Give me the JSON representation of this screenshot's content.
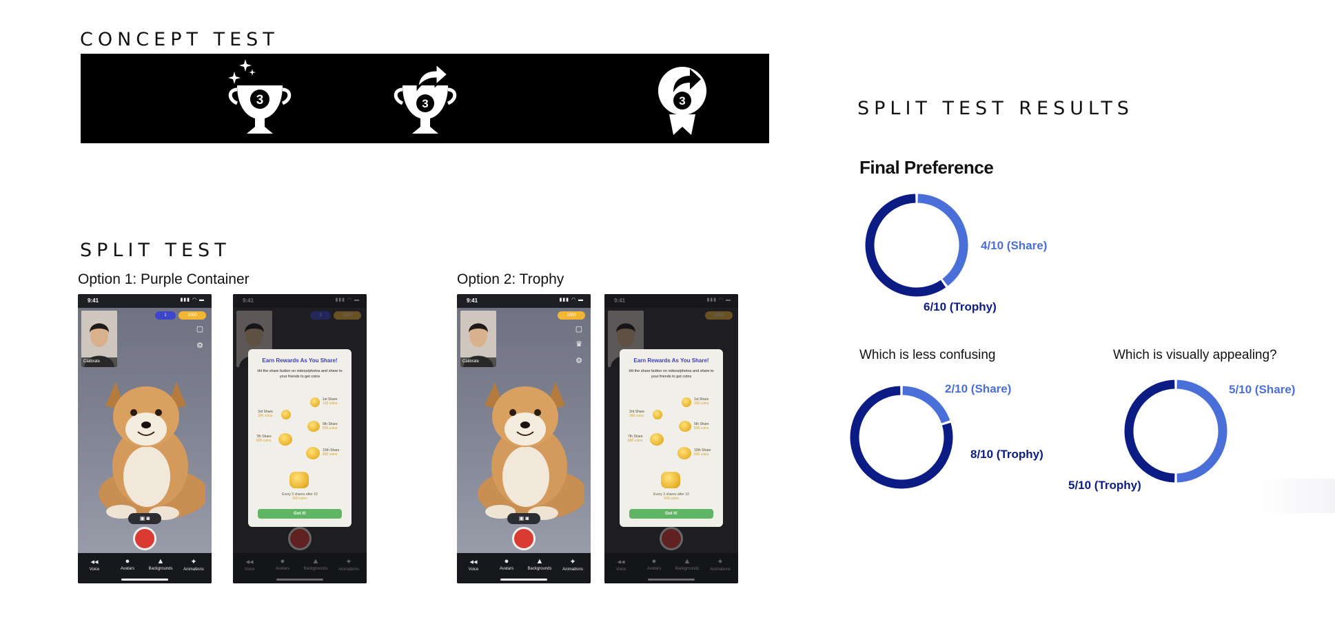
{
  "concept": {
    "title": "CONCEPT TEST",
    "badge_number": "3"
  },
  "split_test": {
    "title": "SPLIT TEST",
    "options": [
      {
        "label": "Option 1: Purple Container",
        "variant": "purple-container"
      },
      {
        "label": "Option 2: Trophy",
        "variant": "trophy"
      }
    ],
    "phone": {
      "time": "9:41",
      "calibrate": "Calibrate",
      "pill_count": "1",
      "pill_coins": "1000",
      "discover": "Discover",
      "rewards": "Rewards",
      "tabs": [
        "Voice",
        "Avatars",
        "Backgrounds",
        "Animations"
      ]
    },
    "modal": {
      "title": "Earn Rewards As You Share!",
      "text": "Hit the share button on videos/photos and share to your friends to get coins",
      "rewards": [
        {
          "label": "1st Share",
          "coins": "100 coins"
        },
        {
          "label": "3rd Share",
          "coins": "300 coins"
        },
        {
          "label": "5th Share",
          "coins": "500 coins"
        },
        {
          "label": "7th Share",
          "coins": "800 coins"
        },
        {
          "label": "10th Share",
          "coins": "800 coins"
        }
      ],
      "footer_line1": "Every 3 shares after 10",
      "footer_line2": "500 coins",
      "button": "Got it!"
    }
  },
  "results": {
    "title": "SPLIT TEST RESULTS"
  },
  "colors": {
    "share": "#4a6fd9",
    "trophy": "#0c1c85",
    "banner": "#000000",
    "got_it": "#5fb563",
    "record": "#d93a31"
  },
  "chart_data": [
    {
      "type": "pie",
      "title": "Final Preference",
      "categories": [
        "Share",
        "Trophy"
      ],
      "values": [
        4,
        6
      ],
      "labels": [
        "4/10 (Share)",
        "6/10 (Trophy)"
      ]
    },
    {
      "type": "pie",
      "title": "Which is less confusing",
      "categories": [
        "Share",
        "Trophy"
      ],
      "values": [
        2,
        8
      ],
      "labels": [
        "2/10 (Share)",
        "8/10 (Trophy)"
      ]
    },
    {
      "type": "pie",
      "title": "Which is visually appealing?",
      "categories": [
        "Share",
        "Trophy"
      ],
      "values": [
        5,
        5
      ],
      "labels": [
        "5/10 (Share)",
        "5/10 (Trophy)"
      ]
    }
  ]
}
